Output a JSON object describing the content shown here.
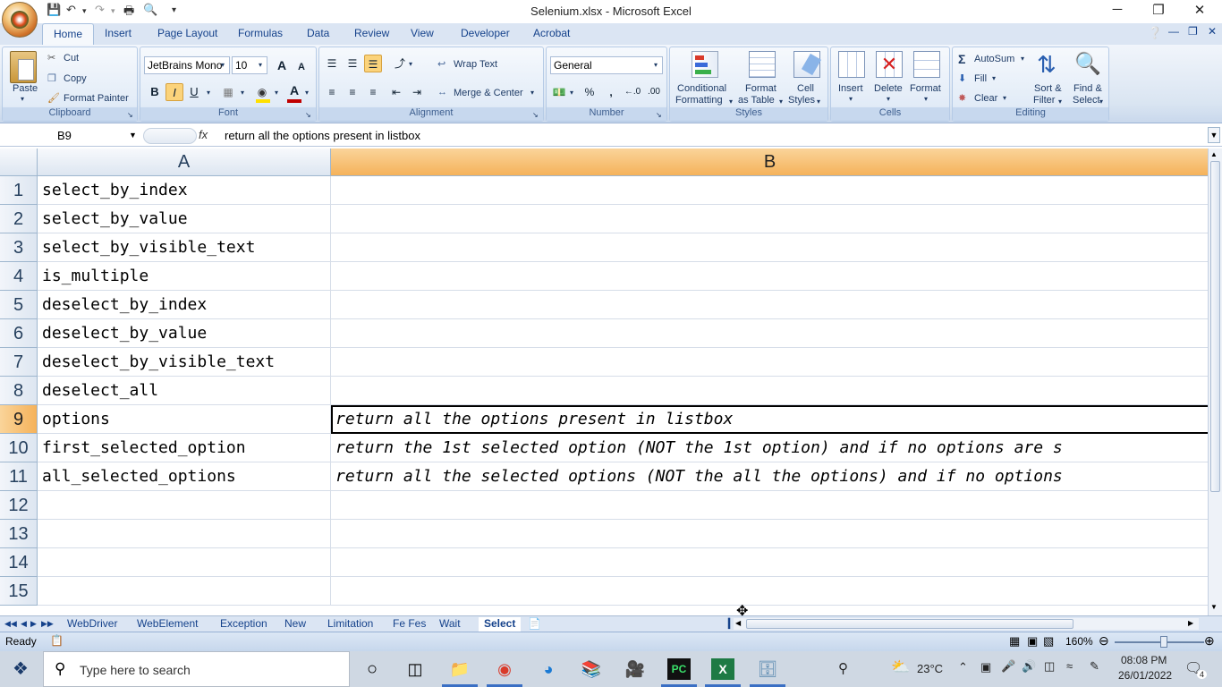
{
  "window": {
    "title": "Selenium.xlsx - Microsoft Excel",
    "minimize": "─",
    "restore": "❐",
    "close": "✕"
  },
  "ribbon_tabs": [
    "Home",
    "Insert",
    "Page Layout",
    "Formulas",
    "Data",
    "Review",
    "View",
    "Developer",
    "Acrobat"
  ],
  "clipboard": {
    "paste": "Paste",
    "cut": "Cut",
    "copy": "Copy",
    "format_painter": "Format Painter",
    "label": "Clipboard"
  },
  "font": {
    "name": "JetBrains Mono",
    "size": "10",
    "bold": "B",
    "italic": "I",
    "underline": "U",
    "grow": "A",
    "shrink": "A",
    "label": "Font"
  },
  "alignment": {
    "wrap_text": "Wrap Text",
    "merge_center": "Merge & Center",
    "label": "Alignment"
  },
  "number": {
    "format": "General",
    "percent": "%",
    "comma": ",",
    "label": "Number"
  },
  "styles": {
    "conditional": "Conditional",
    "formatting": "Formatting",
    "format": "Format",
    "as_table": "as Table",
    "cell": "Cell",
    "cell_styles": "Styles",
    "label": "Styles"
  },
  "cells": {
    "insert": "Insert",
    "delete": "Delete",
    "format": "Format",
    "label": "Cells"
  },
  "editing": {
    "autosum": "AutoSum",
    "fill": "Fill",
    "clear": "Clear",
    "sort_filter_1": "Sort &",
    "sort_filter_2": "Filter",
    "find_select_1": "Find &",
    "find_select_2": "Select",
    "label": "Editing"
  },
  "formula_bar": {
    "name_box": "B9",
    "fx": "fx",
    "formula": "return all the options present in listbox"
  },
  "columns": [
    "A",
    "B"
  ],
  "rows": [
    {
      "num": "1",
      "a": "select_by_index",
      "b": ""
    },
    {
      "num": "2",
      "a": "select_by_value",
      "b": ""
    },
    {
      "num": "3",
      "a": "select_by_visible_text",
      "b": ""
    },
    {
      "num": "4",
      "a": "is_multiple",
      "b": ""
    },
    {
      "num": "5",
      "a": "deselect_by_index",
      "b": ""
    },
    {
      "num": "6",
      "a": "deselect_by_value",
      "b": ""
    },
    {
      "num": "7",
      "a": "deselect_by_visible_text",
      "b": ""
    },
    {
      "num": "8",
      "a": "deselect_all",
      "b": ""
    },
    {
      "num": "9",
      "a": "options",
      "b": "return all the options present in listbox"
    },
    {
      "num": "10",
      "a": "first_selected_option",
      "b": "return the 1st selected option (NOT the 1st option) and if no options are s"
    },
    {
      "num": "11",
      "a": "all_selected_options",
      "b": "return all the selected options (NOT the all the options) and if no options"
    },
    {
      "num": "12",
      "a": "",
      "b": ""
    },
    {
      "num": "13",
      "a": "",
      "b": ""
    },
    {
      "num": "14",
      "a": "",
      "b": ""
    },
    {
      "num": "15",
      "a": "",
      "b": ""
    }
  ],
  "sheet_tabs": [
    "WebDriver",
    "WebElement",
    "Exception",
    "New",
    "Limitation",
    "Fe Fes",
    "Wait",
    "Select"
  ],
  "active_sheet": "Select",
  "status": {
    "ready": "Ready",
    "zoom": "160%"
  },
  "taskbar": {
    "search_placeholder": "Type here to search",
    "weather": "23°C",
    "time": "08:08 PM",
    "date": "26/01/2022",
    "notifications": "4"
  }
}
